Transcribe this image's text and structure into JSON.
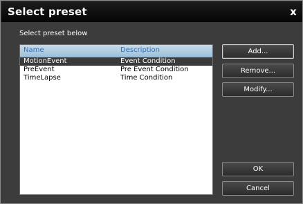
{
  "window": {
    "title": "Select preset",
    "close_label": "x"
  },
  "prompt": "Select preset below",
  "list": {
    "columns": [
      "Name",
      "Description"
    ],
    "rows": [
      {
        "name": "MotionEvent",
        "description": "Event Condition",
        "selected": true
      },
      {
        "name": "PreEvent",
        "description": "Pre Event Condition",
        "selected": false
      },
      {
        "name": "TimeLapse",
        "description": "Time Condition",
        "selected": false
      }
    ]
  },
  "buttons": {
    "add": "Add...",
    "remove": "Remove...",
    "modify": "Modify...",
    "ok": "OK",
    "cancel": "Cancel"
  }
}
